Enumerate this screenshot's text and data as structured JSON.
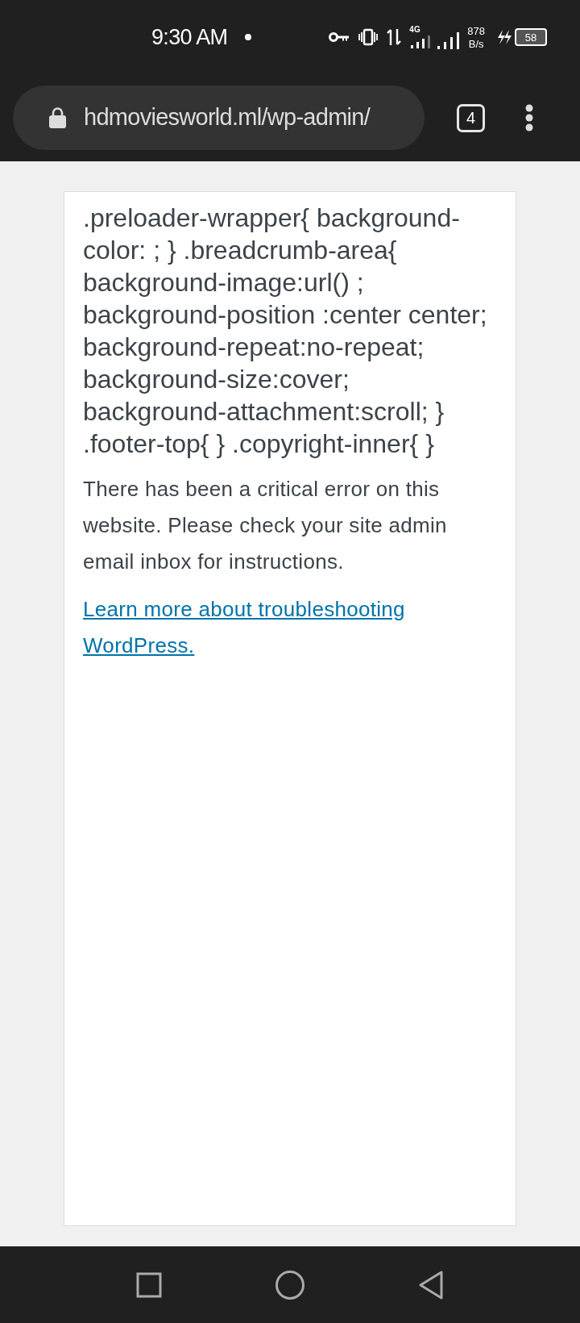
{
  "status_bar": {
    "time": "9:30 AM",
    "network_type": "4G",
    "speed_value": "878",
    "speed_unit": "B/s",
    "battery": "58",
    "charging": true
  },
  "browser": {
    "url": "hdmoviesworld.ml/wp-admin/",
    "tab_count": "4"
  },
  "page": {
    "css_text": ".preloader-wrapper{ background-color: ; } .breadcrumb-area{ background-image:url() ; background-position :center center; background-repeat:no-repeat; background-size:cover; background-attachment:scroll; } .footer-top{ } .copyright-inner{ }",
    "message": "There has been a critical error on this website. Please check your site admin email inbox for instructions.",
    "link": "Learn more about troubleshooting WordPress."
  }
}
